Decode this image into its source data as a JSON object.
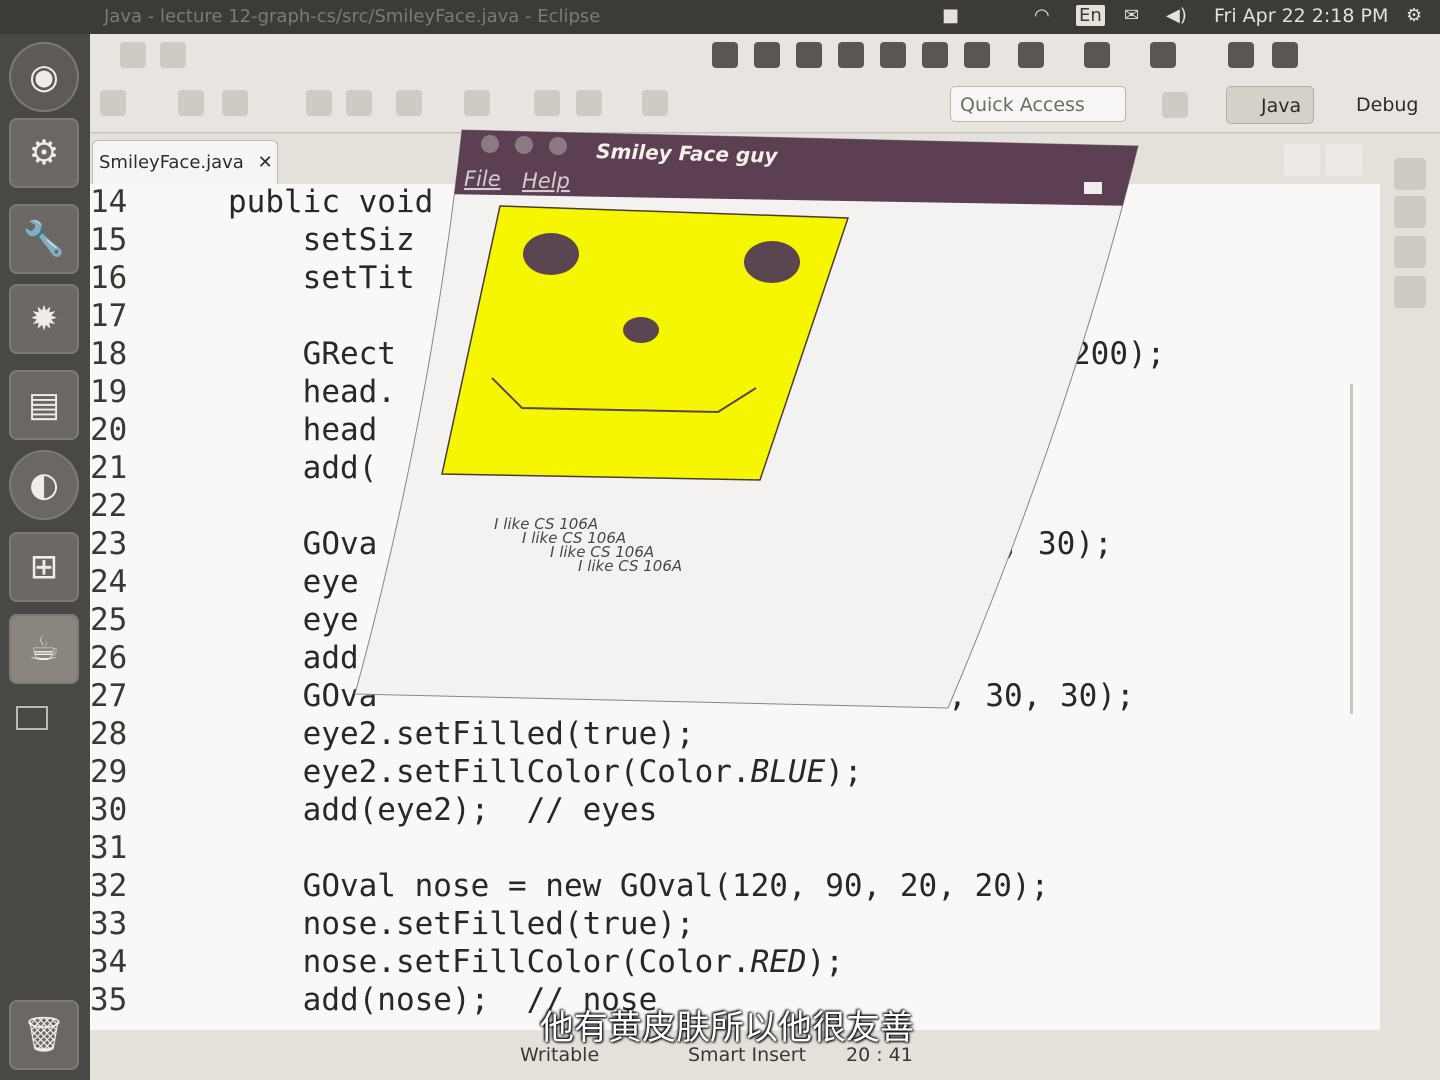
{
  "top_panel": {
    "window_title": "Java - lecture 12-graph-cs/src/SmileyFace.java - Eclipse",
    "keyboard": "En",
    "clock": "Fri Apr 22  2:18 PM"
  },
  "quick_access": {
    "label": "Quick Access"
  },
  "perspectives": {
    "java": "Java",
    "debug": "Debug"
  },
  "editor": {
    "tab_label": "SmileyFace.java",
    "line_numbers": [
      "14",
      "15",
      "16",
      "17",
      "18",
      "19",
      "20",
      "21",
      "22",
      "23",
      "24",
      "25",
      "26",
      "27",
      "28",
      "29",
      "30",
      "31",
      "32",
      "33",
      "34",
      "35"
    ],
    "lines": [
      "public void",
      "    setSiz",
      "    setTit",
      "",
      "    GRect",
      "    head.",
      "    head",
      "    add(",
      "",
      "    GOva",
      "    eye",
      "    eye",
      "    add",
      "    GOva",
      "    eye2.setFilled(true);",
      "    eye2.setFillColor(Color.BLUE);",
      "    add(eye2);  // eyes",
      "",
      "    GOval nose = new GOval(120, 90, 20, 20);",
      "    nose.setFilled(true);",
      "    nose.setFillColor(Color.RED);",
      "    add(nose);  // nose"
    ],
    "fragments": {
      "line18_tail": "200);",
      "line23_tail": "0, 30);",
      "line27_tail": ", 30, 30);"
    }
  },
  "status_bar": {
    "writable": "Writable",
    "insert_mode": "Smart Insert",
    "position": "20 : 41"
  },
  "subtitle": "他有黄皮肤所以他很友善",
  "applet": {
    "title": "Smiley Face guy",
    "menu_file": "File",
    "menu_help": "Help",
    "face_color": "#f6f600",
    "feature_color": "#5a4650",
    "messages": [
      "I like CS 106A",
      "I like CS 106A",
      "I like CS 106A",
      "I like CS 106A"
    ]
  },
  "colors": {
    "panel": "#3c3b37",
    "launcher": "#4a4845",
    "titlebar": "#5c3f52"
  }
}
